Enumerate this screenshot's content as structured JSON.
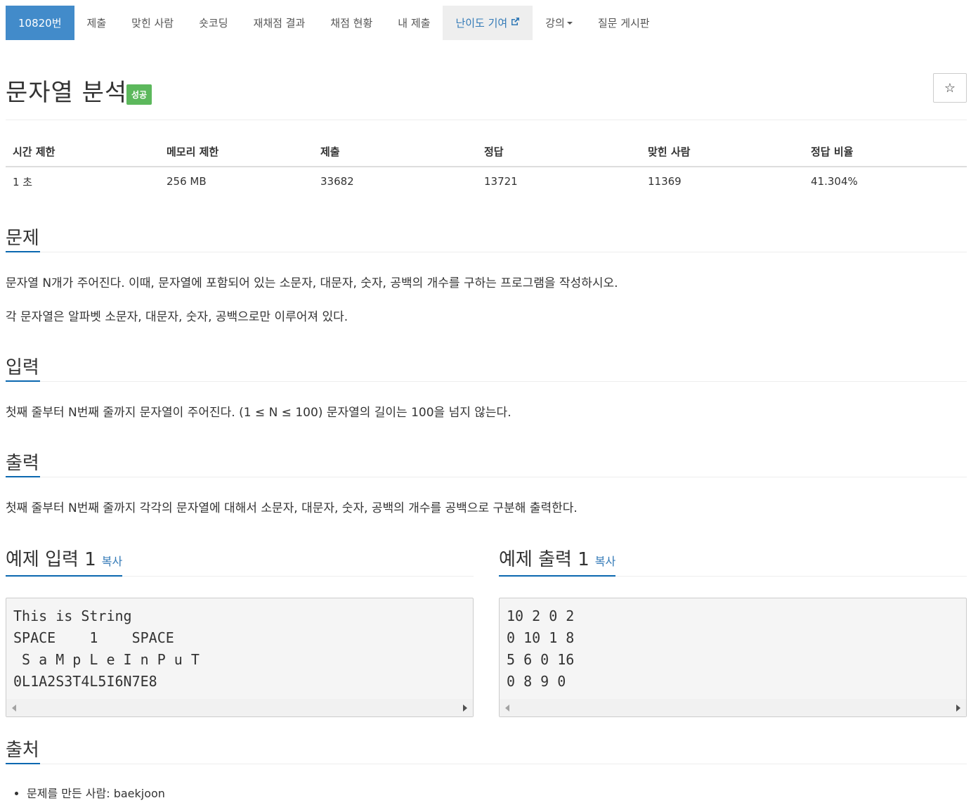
{
  "nav": {
    "tabs": [
      {
        "label": "10820번"
      },
      {
        "label": "제출"
      },
      {
        "label": "맞힌 사람"
      },
      {
        "label": "숏코딩"
      },
      {
        "label": "재채점 결과"
      },
      {
        "label": "채점 현황"
      },
      {
        "label": "내 제출"
      },
      {
        "label": "난이도 기여",
        "icon": "external-link-icon"
      },
      {
        "label": "강의",
        "icon": "caret-down-icon"
      },
      {
        "label": "질문 게시판"
      }
    ]
  },
  "problem": {
    "title": "문자열 분석",
    "status_badge": "성공",
    "star_icon": "☆"
  },
  "info_table": {
    "headers": [
      "시간 제한",
      "메모리 제한",
      "제출",
      "정답",
      "맞힌 사람",
      "정답 비율"
    ],
    "values": [
      "1 초",
      "256 MB",
      "33682",
      "13721",
      "11369",
      "41.304%"
    ]
  },
  "sections": {
    "description": {
      "heading": "문제",
      "paragraphs": [
        "문자열 N개가 주어진다. 이때, 문자열에 포함되어 있는 소문자, 대문자, 숫자, 공백의 개수를 구하는 프로그램을 작성하시오.",
        "각 문자열은 알파벳 소문자, 대문자, 숫자, 공백으로만 이루어져 있다."
      ]
    },
    "input": {
      "heading": "입력",
      "text": "첫째 줄부터 N번째 줄까지 문자열이 주어진다. (1 ≤ N ≤ 100) 문자열의 길이는 100을 넘지 않는다."
    },
    "output": {
      "heading": "출력",
      "text": "첫째 줄부터 N번째 줄까지 각각의 문자열에 대해서 소문자, 대문자, 숫자, 공백의 개수를 공백으로 구분해 출력한다."
    },
    "sample_input": {
      "heading": "예제 입력 1",
      "copy_label": "복사",
      "content": "This is String\nSPACE    1    SPACE\n S a M p L e I n P u T\n0L1A2S3T4L5I6N7E8"
    },
    "sample_output": {
      "heading": "예제 출력 1",
      "copy_label": "복사",
      "content": "10 2 0 2\n0 10 1 8\n5 6 0 16\n0 8 9 0"
    },
    "source": {
      "heading": "출처",
      "items": [
        "문제를 만든 사람: baekjoon"
      ]
    }
  },
  "colors": {
    "active_tab": "#428bca",
    "link": "#337ab7",
    "success_badge": "#5cb85c",
    "heading_underline": "#0b68b0"
  }
}
